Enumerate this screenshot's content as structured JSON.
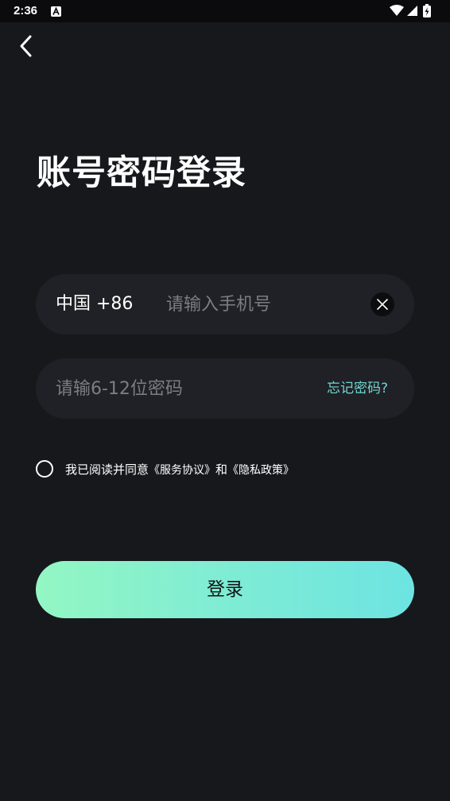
{
  "status_bar": {
    "time": "2:36",
    "notification_icon": "a-app-icon",
    "icons": [
      "wifi-icon",
      "cell-signal-icon",
      "battery-charging-icon"
    ]
  },
  "nav": {
    "back_icon": "chevron-left-icon"
  },
  "title": "账号密码登录",
  "phone_field": {
    "country_code": "中国 +86",
    "placeholder": "请输入手机号",
    "value": "",
    "clear_icon": "close-icon"
  },
  "password_field": {
    "placeholder": "请输6-12位密码",
    "value": "",
    "forgot_label": "忘记密码?"
  },
  "agreement": {
    "checked": false,
    "prefix": "我已阅读并同意",
    "service_link": "《服务协议》",
    "and": "和",
    "privacy_link": "《隐私政策》"
  },
  "login_button": {
    "label": "登录"
  },
  "colors": {
    "background": "#17181c",
    "field_background": "#202126",
    "accent": "#6fd6d0",
    "button_gradient_start": "#93f7c3",
    "button_gradient_end": "#6de4e2"
  }
}
